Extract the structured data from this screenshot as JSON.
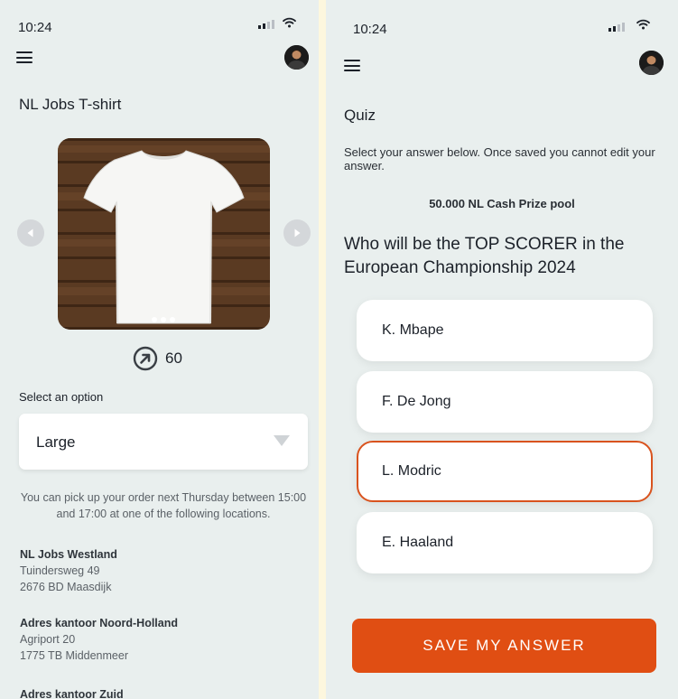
{
  "left_screen": {
    "status": {
      "time": "10:24"
    },
    "title": "NL Jobs T-shirt",
    "points": "60",
    "select_label": "Select an option",
    "selected_option": "Large",
    "pickup_note": "You can pick up your order next Thursday between 15:00 and 17:00 at one of the following locations.",
    "locations": [
      {
        "name": "NL Jobs Westland",
        "street": "Tuindersweg 49",
        "city": "2676 BD Maasdijk"
      },
      {
        "name": "Adres kantoor Noord-Holland",
        "street": "Agriport 20",
        "city": "1775 TB Middenmeer"
      },
      {
        "name": "Adres kantoor Zuid"
      }
    ]
  },
  "right_screen": {
    "status": {
      "time": "10:24"
    },
    "title": "Quiz",
    "description": "Select your answer below. Once saved you cannot edit your answer.",
    "prize": "50.000 NL Cash Prize pool",
    "question": "Who will be the TOP SCORER in the European Championship 2024",
    "options": [
      "K. Mbape",
      "F. De Jong",
      "L. Modric",
      "E. Haaland"
    ],
    "selected_index": 2,
    "save_label": "SAVE MY ANSWER"
  },
  "icons": [
    "menu-icon",
    "avatar",
    "arrow-left-icon",
    "arrow-right-icon",
    "points-arrow-icon",
    "dropdown-caret-icon",
    "signal-icon",
    "wifi-icon"
  ],
  "colors": {
    "accent": "#e04e13",
    "background": "#e9efee",
    "selected_border": "#d9531e"
  }
}
